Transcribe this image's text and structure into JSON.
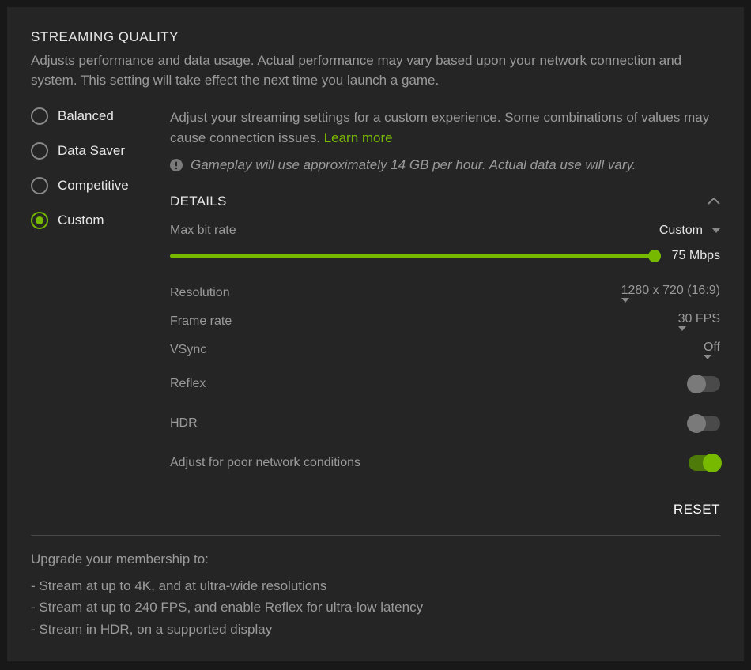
{
  "section": {
    "title": "STREAMING QUALITY",
    "description": "Adjusts performance and data usage. Actual performance may vary based upon your network connection and system. This setting will take effect the next time you launch a game."
  },
  "quality_options": {
    "balanced": "Balanced",
    "data_saver": "Data Saver",
    "competitive": "Competitive",
    "custom": "Custom",
    "selected": "custom"
  },
  "custom": {
    "desc_prefix": "Adjust your streaming settings for a custom experience. Some combinations of values may cause connection issues. ",
    "learn_more": "Learn more",
    "gameplay_info": "Gameplay will use approximately 14 GB per hour. Actual data use will vary."
  },
  "details": {
    "header": "DETAILS",
    "max_bit_rate": {
      "label": "Max bit rate",
      "value": "Custom",
      "slider_value": "75 Mbps"
    },
    "resolution": {
      "label": "Resolution",
      "value": "1280 x 720 (16:9)"
    },
    "frame_rate": {
      "label": "Frame rate",
      "value": "30 FPS"
    },
    "vsync": {
      "label": "VSync",
      "value": "Off"
    },
    "reflex": {
      "label": "Reflex",
      "on": false
    },
    "hdr": {
      "label": "HDR",
      "on": false
    },
    "adjust_network": {
      "label": "Adjust for poor network conditions",
      "on": true
    },
    "reset": "RESET"
  },
  "upgrade": {
    "lead": "Upgrade your membership to:",
    "items": [
      "- Stream at up to 4K, and at ultra-wide resolutions",
      "- Stream at up to 240 FPS, and enable Reflex for ultra-low latency",
      "- Stream in HDR, on a supported display"
    ]
  }
}
